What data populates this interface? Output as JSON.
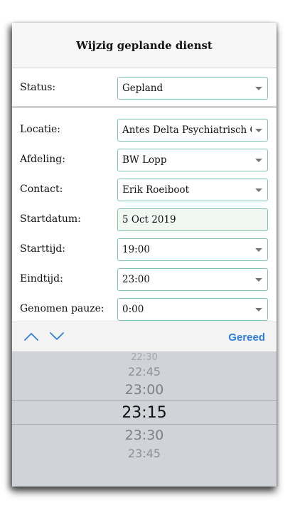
{
  "header": {
    "title": "Wijzig geplande dienst"
  },
  "status": {
    "label": "Status:",
    "value": "Gepland"
  },
  "form": {
    "location": {
      "label": "Locatie:",
      "value": "Antes Delta Psychiatrisch Centrum"
    },
    "department": {
      "label": "Afdeling:",
      "value": "BW Lopp"
    },
    "contact": {
      "label": "Contact:",
      "value": "Erik Roeiboot"
    },
    "start_date": {
      "label": "Startdatum:",
      "value": "5 Oct 2019"
    },
    "start_time": {
      "label": "Starttijd:",
      "value": "19:00"
    },
    "end_time": {
      "label": "Eindtijd:",
      "value": "23:00"
    },
    "break": {
      "label": "Genomen pauze:",
      "value": "0:00"
    }
  },
  "toolbar": {
    "done_label": "Gereed",
    "prev_icon": "chevron-up-icon",
    "next_icon": "chevron-down-icon",
    "accent": "#2f7ee0"
  },
  "picker": {
    "items": [
      "22:30",
      "22:45",
      "23:00",
      "23:15",
      "23:30",
      "23:45"
    ],
    "selected": "23:15"
  }
}
